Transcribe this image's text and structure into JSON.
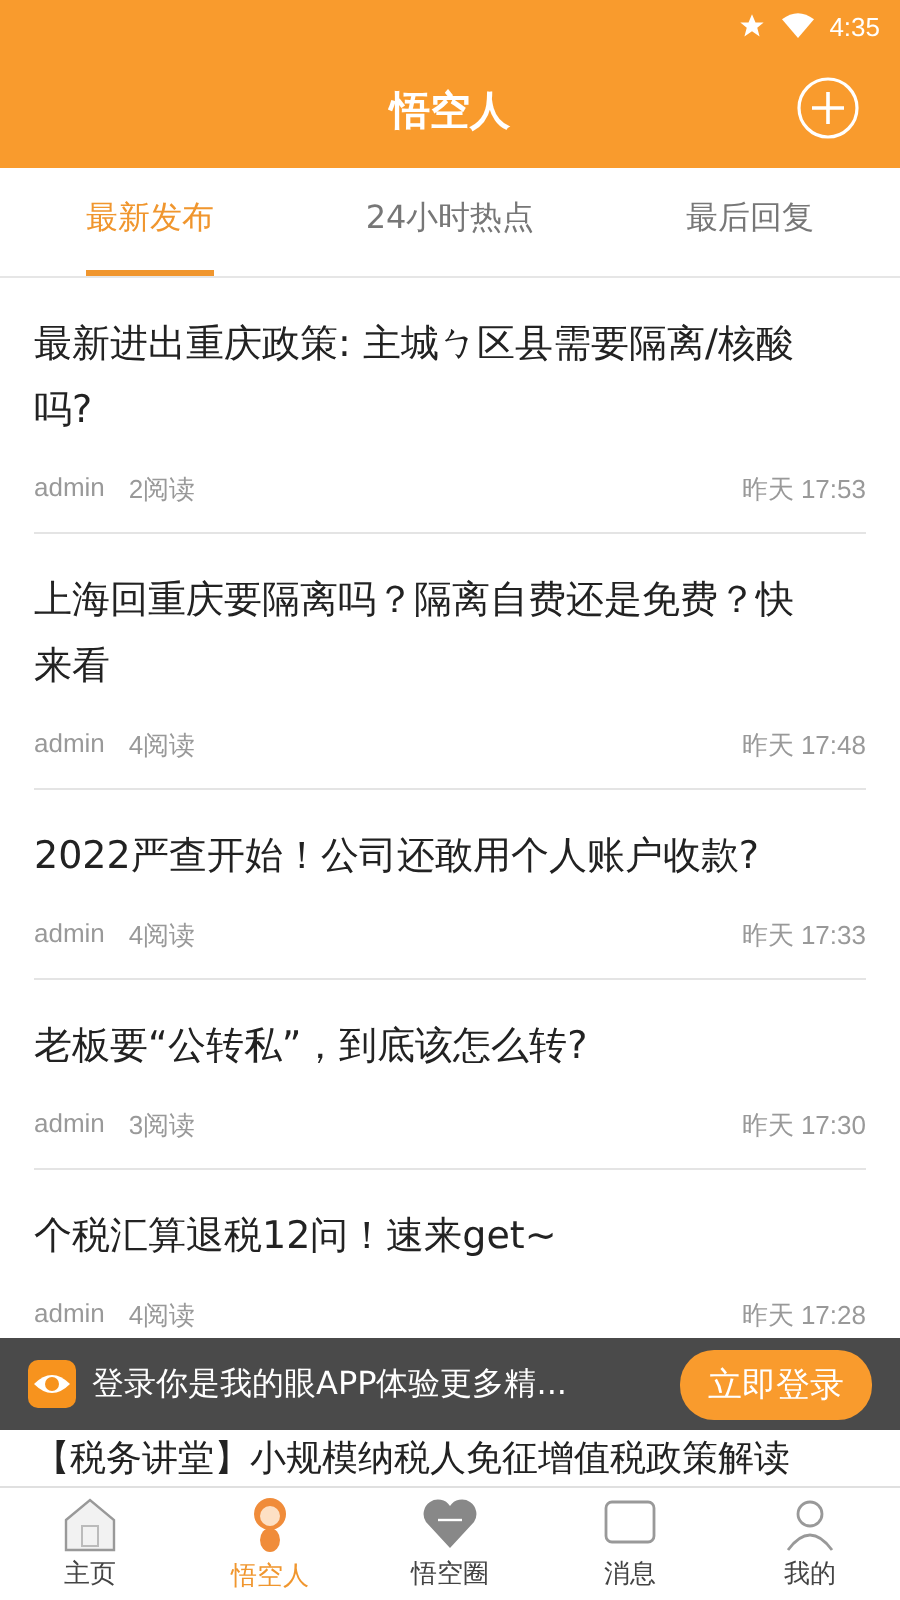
{
  "status_bar": {
    "time": "4:35"
  },
  "header": {
    "title": "悟空人"
  },
  "tabs": [
    {
      "label": "最新发布",
      "selected": true
    },
    {
      "label": "24小时热点",
      "selected": false
    },
    {
      "label": "最后回复",
      "selected": false
    }
  ],
  "articles": [
    {
      "title": "最新进出重庆政策: 主城ㄅ区县需要隔离/核酸吗?",
      "author": "admin",
      "reads": "2阅读",
      "time": "昨天 17:53"
    },
    {
      "title": "上海回重庆要隔离吗？隔离自费还是免费？快来看",
      "author": "admin",
      "reads": "4阅读",
      "time": "昨天 17:48"
    },
    {
      "title": "2022严查开始！公司还敢用个人账户收款?",
      "author": "admin",
      "reads": "4阅读",
      "time": "昨天 17:33"
    },
    {
      "title": "老板要“公转私”，到底该怎么转?",
      "author": "admin",
      "reads": "3阅读",
      "time": "昨天 17:30"
    },
    {
      "title": "个税汇算退税12问！速来get~",
      "author": "admin",
      "reads": "4阅读",
      "time": "昨天 17:28"
    },
    {
      "title": "【税务讲堂】小规模纳税人免征增值税政策解读"
    }
  ],
  "login_banner": {
    "text": "登录你是我的眼APP体验更多精...",
    "button": "立即登录"
  },
  "bottom_nav": [
    {
      "label": "主页",
      "selected": false
    },
    {
      "label": "悟空人",
      "selected": true
    },
    {
      "label": "悟空圈",
      "selected": false
    },
    {
      "label": "消息",
      "selected": false
    },
    {
      "label": "我的",
      "selected": false
    }
  ]
}
